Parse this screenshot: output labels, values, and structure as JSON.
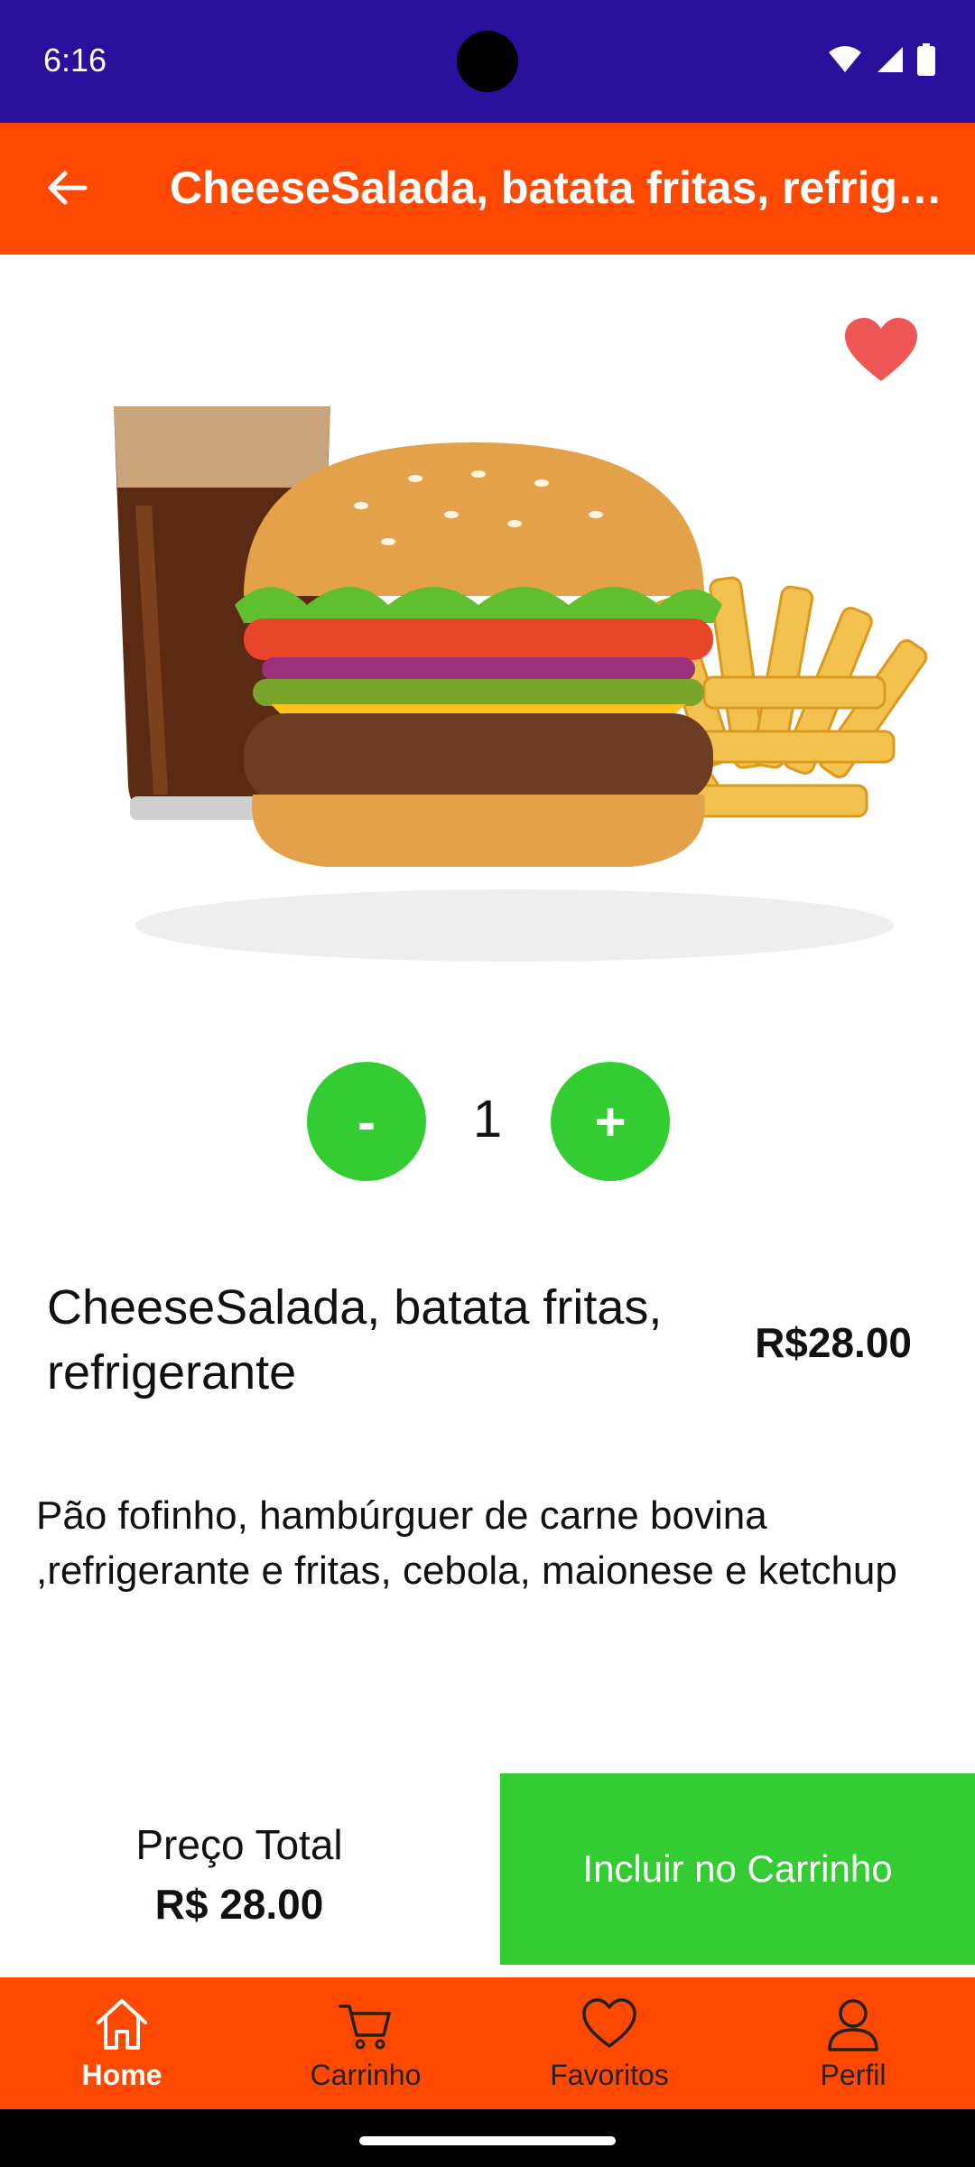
{
  "status_bar": {
    "time": "6:16"
  },
  "app_bar": {
    "title": "CheeseSalada, batata fritas, refrigerante"
  },
  "quantity": {
    "minus_label": "-",
    "value": "1",
    "plus_label": "+"
  },
  "product": {
    "name": "CheeseSalada, batata fritas, refrigerante",
    "price": "R$28.00",
    "description": "Pão fofinho, hambúrguer de carne bovina ,refrigerante e fritas, cebola, maionese e ketchup"
  },
  "footer": {
    "total_label": "Preço Total",
    "total_value": "R$ 28.00",
    "add_to_cart_label": "Incluir no Carrinho"
  },
  "bottom_nav": {
    "items": [
      {
        "label": "Home",
        "icon": "home-icon",
        "active": true
      },
      {
        "label": "Carrinho",
        "icon": "cart-icon",
        "active": false
      },
      {
        "label": "Favoritos",
        "icon": "heart-outline-icon",
        "active": false
      },
      {
        "label": "Perfil",
        "icon": "person-icon",
        "active": false
      }
    ]
  },
  "colors": {
    "status_bar": "#2a0f9c",
    "app_bar": "#ff4800",
    "accent_green": "#33cc33",
    "favorite_red": "#ee5555"
  }
}
